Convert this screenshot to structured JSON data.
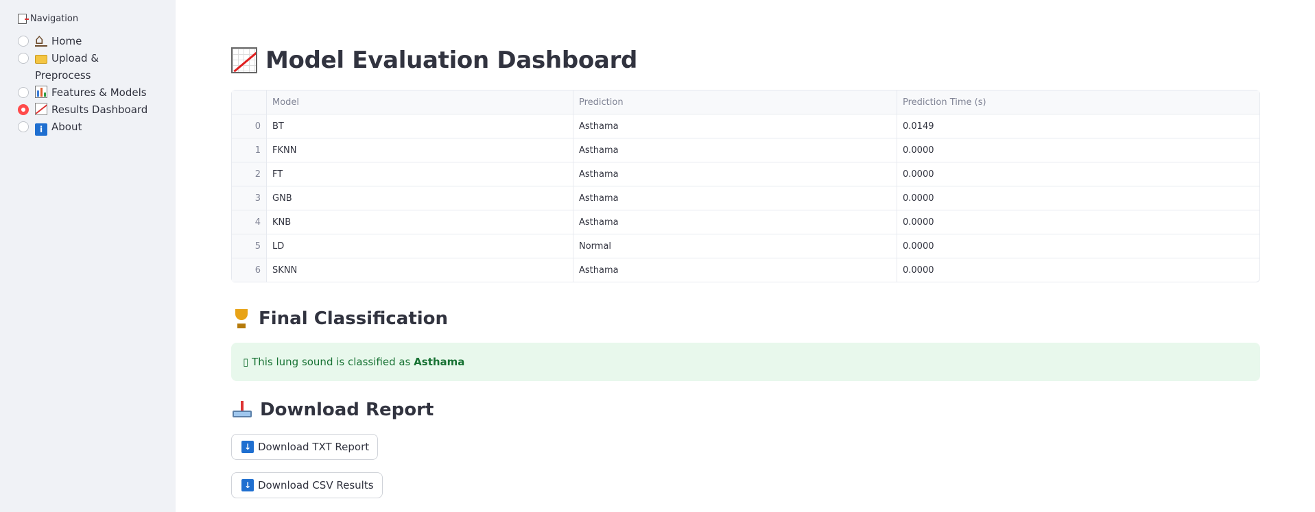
{
  "sidebar": {
    "title": "Navigation",
    "items": [
      {
        "label": "Home",
        "icon": "house-icon",
        "selected": false
      },
      {
        "label": "Upload & Preprocess",
        "icon": "folder-icon",
        "selected": false
      },
      {
        "label": "Features & Models",
        "icon": "bar-chart-icon",
        "selected": false
      },
      {
        "label": "Results Dashboard",
        "icon": "trend-chart-icon",
        "selected": true
      },
      {
        "label": "About",
        "icon": "info-icon",
        "selected": false
      }
    ]
  },
  "main": {
    "title": "Model Evaluation Dashboard",
    "table": {
      "columns": [
        "",
        "Model",
        "Prediction",
        "Prediction Time (s)"
      ],
      "rows": [
        [
          "0",
          "BT",
          "Asthama",
          "0.0149"
        ],
        [
          "1",
          "FKNN",
          "Asthama",
          "0.0000"
        ],
        [
          "2",
          "FT",
          "Asthama",
          "0.0000"
        ],
        [
          "3",
          "GNB",
          "Asthama",
          "0.0000"
        ],
        [
          "4",
          "KNB",
          "Asthama",
          "0.0000"
        ],
        [
          "5",
          "LD",
          "Normal",
          "0.0000"
        ],
        [
          "6",
          "SKNN",
          "Asthama",
          "0.0000"
        ]
      ]
    },
    "final": {
      "heading": "Final Classification",
      "glyph": "▯",
      "prefix": "This lung sound is classified as",
      "result": "Asthama"
    },
    "download": {
      "heading": "Download Report",
      "txt_label": "Download TXT Report",
      "csv_label": "Download CSV Results"
    }
  },
  "colors": {
    "accent": "#ff4b4b",
    "success_bg": "#e8f8ec",
    "success_text": "#177233",
    "sidebar_bg": "#f0f2f6"
  }
}
